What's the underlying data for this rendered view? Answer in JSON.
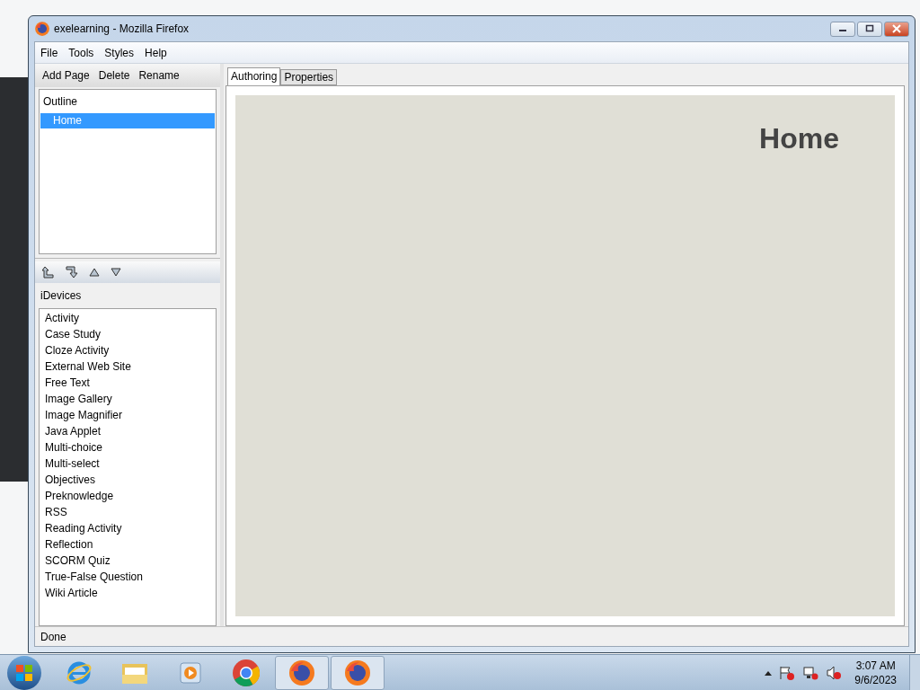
{
  "window": {
    "title": "exelearning - Mozilla Firefox"
  },
  "menu": [
    "File",
    "Tools",
    "Styles",
    "Help"
  ],
  "outline_toolbar": [
    "Add Page",
    "Delete",
    "Rename"
  ],
  "outline": {
    "title": "Outline",
    "items": [
      {
        "label": "Home",
        "selected": true
      }
    ]
  },
  "idevices": {
    "title": "iDevices",
    "items": [
      "Activity",
      "Case Study",
      "Cloze Activity",
      "External Web Site",
      "Free Text",
      "Image Gallery",
      "Image Magnifier",
      "Java Applet",
      "Multi-choice",
      "Multi-select",
      "Objectives",
      "Preknowledge",
      "RSS",
      "Reading Activity",
      "Reflection",
      "SCORM Quiz",
      "True-False Question",
      "Wiki Article"
    ]
  },
  "tabs": [
    {
      "label": "Authoring",
      "selected": true
    },
    {
      "label": "Properties",
      "selected": false
    }
  ],
  "page": {
    "heading": "Home"
  },
  "status_bar": {
    "text": "Done"
  },
  "taskbar": {
    "apps": [
      {
        "kind": "browser-e",
        "selected": false
      },
      {
        "kind": "folder",
        "selected": false
      },
      {
        "kind": "media",
        "selected": false
      },
      {
        "kind": "chrome",
        "selected": false
      },
      {
        "kind": "firefox",
        "selected": true
      },
      {
        "kind": "firefox",
        "selected": true
      }
    ],
    "time": "3:07 AM",
    "date": "9/6/2023"
  }
}
